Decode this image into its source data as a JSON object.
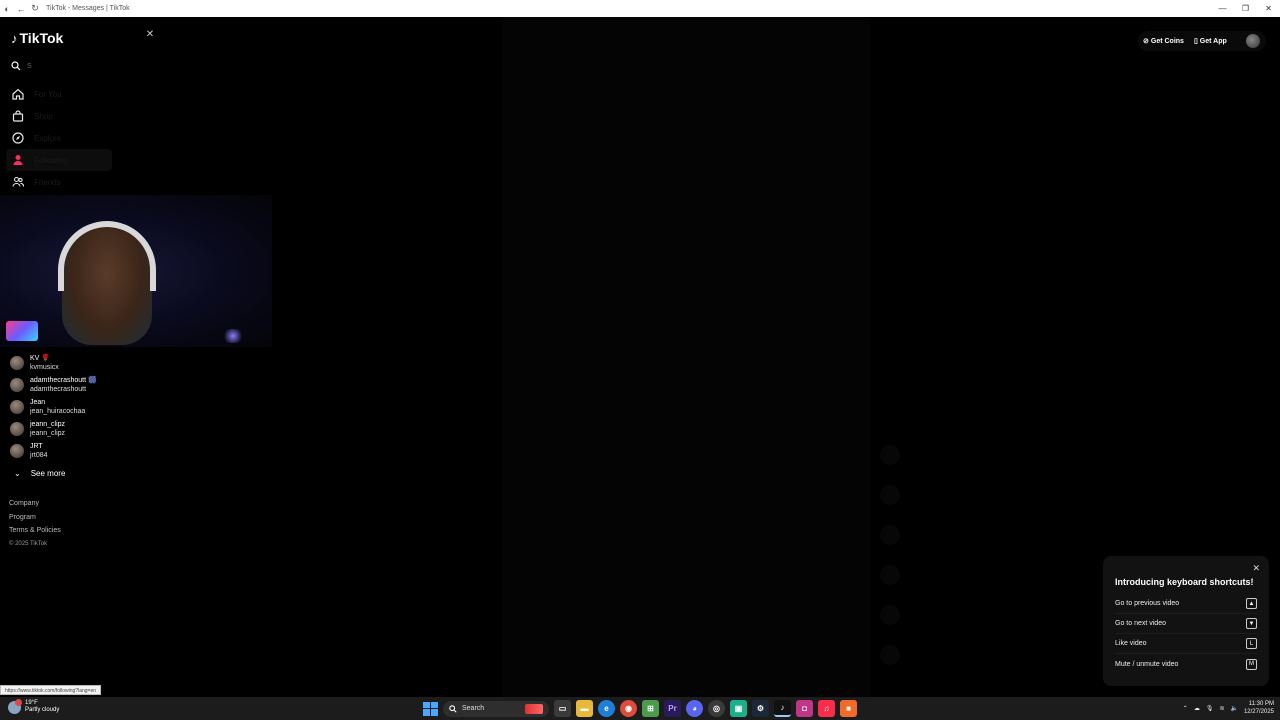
{
  "browser": {
    "tab_title": "TikTok - Messages | TikTok",
    "url_status": "https://www.tiktok.com/following?lang=en"
  },
  "sidebar": {
    "logo_text": "TikTok",
    "search_placeholder": "S",
    "nav": [
      {
        "label": "For You",
        "icon": "home-icon"
      },
      {
        "label": "Shop",
        "icon": "shop-bag-icon"
      },
      {
        "label": "Explore",
        "icon": "compass-icon"
      },
      {
        "label": "Following",
        "icon": "following-icon"
      },
      {
        "label": "Friends",
        "icon": "friends-icon"
      }
    ],
    "following_accounts": [
      {
        "display": "KV 🌹",
        "handle": "kvmusicx"
      },
      {
        "display": "adamthecrashoutt 🎆",
        "handle": "adamthecrashoutt"
      },
      {
        "display": "Jean",
        "handle": "jean_huiracochaa"
      },
      {
        "display": "jeann_clipz",
        "handle": "jeann_clipz"
      },
      {
        "display": "JRT",
        "handle": "jrt084"
      }
    ],
    "see_more": "See more",
    "footer": {
      "company": "Company",
      "program": "Program",
      "terms": "Terms & Policies",
      "copyright": "© 2025 TikTok"
    }
  },
  "header": {
    "get_coins": "Get Coins",
    "get_app": "Get App"
  },
  "shortcuts_popup": {
    "title": "Introducing keyboard shortcuts!",
    "rows": [
      {
        "label": "Go to previous video",
        "key": "▲"
      },
      {
        "label": "Go to next video",
        "key": "▼"
      },
      {
        "label": "Like video",
        "key": "L"
      },
      {
        "label": "Mute / unmute video",
        "key": "M"
      }
    ]
  },
  "taskbar": {
    "weather_temp": "19°F",
    "weather_desc": "Partly cloudy",
    "search_label": "Search",
    "time": "11:30 PM",
    "date": "12/27/2025"
  },
  "colors": {
    "accent": "#fe2c55",
    "background": "#000000",
    "popup": "#121212"
  }
}
